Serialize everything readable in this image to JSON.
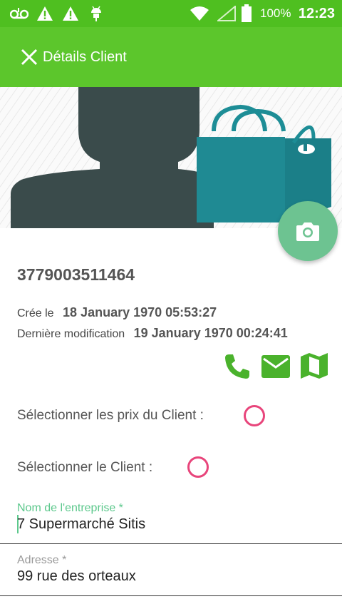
{
  "status_bar": {
    "battery_text": "100%",
    "time": "12:23",
    "icons": [
      "voicemail-icon",
      "warning-icon",
      "warning-icon",
      "android-debug-icon",
      "wifi-icon",
      "signal-icon",
      "battery-icon"
    ]
  },
  "toolbar": {
    "title": "Détails Client",
    "close_icon": "close-icon"
  },
  "colors": {
    "status_bar": "#4fbf20",
    "toolbar": "#5cc62c",
    "fab": "#6dc391",
    "radio": "#e8457b",
    "action_icons": "#4ab22c",
    "field_label_active": "#5cc88c"
  },
  "client": {
    "id": "3779003511464",
    "created_label": "Crée le",
    "created_value": "18 January 1970 05:53:27",
    "modified_label": "Dernière modification",
    "modified_value": "19 January 1970 00:24:41"
  },
  "actions": [
    "phone-icon",
    "email-icon",
    "map-icon"
  ],
  "selectors": {
    "prices_label": "Sélectionner les prix du Client :",
    "client_label": "Sélectionner le Client :"
  },
  "form": {
    "company_label": "Nom de l'entreprise *",
    "company_value": "7 Supermarché Sitis",
    "address_label": "Adresse *",
    "address_value": "99 rue des orteaux"
  }
}
